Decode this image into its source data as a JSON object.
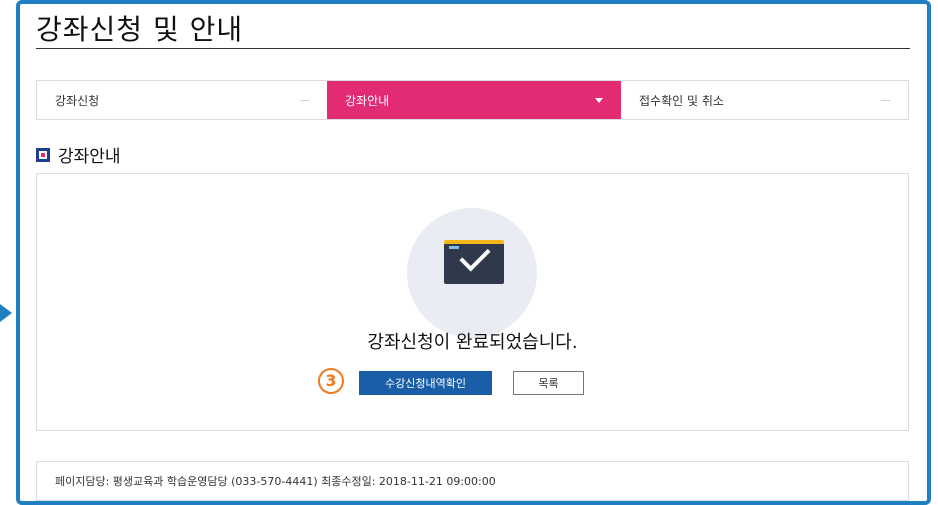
{
  "page": {
    "title": "강좌신청 및 안내"
  },
  "tabs": [
    {
      "label": "강좌신청",
      "active": false
    },
    {
      "label": "강좌안내",
      "active": true
    },
    {
      "label": "접수확인 및 취소",
      "active": false
    }
  ],
  "section": {
    "title": "강좌안내"
  },
  "completion": {
    "icon": "check-window-icon",
    "message": "강좌신청이 완료되었습니다.",
    "step_number": "3",
    "confirm_label": "수강신청내역확인",
    "list_label": "목록"
  },
  "footer": {
    "text": "페이지담당:  평생교육과 학습운영담당 (033-570-4441)   최종수정일:  2018-11-21 09:00:00"
  },
  "colors": {
    "frame": "#1f7fc1",
    "active_tab": "#e32a74",
    "primary_button": "#1a5ea8",
    "step_badge": "#f07a1f"
  }
}
